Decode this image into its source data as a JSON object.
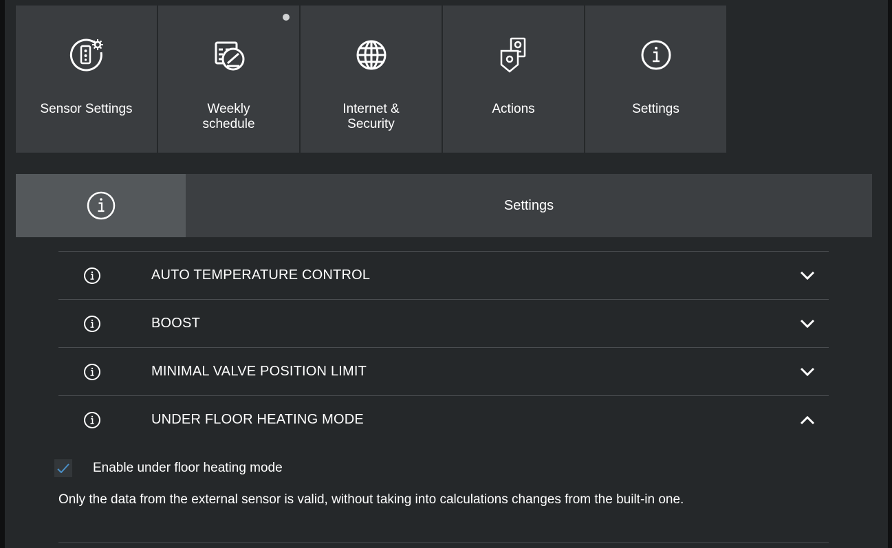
{
  "tiles": [
    {
      "label": "Sensor Settings",
      "icon": "sensor-settings-icon"
    },
    {
      "label": "Weekly\nschedule",
      "icon": "weekly-schedule-icon",
      "badge": true
    },
    {
      "label": "Internet &\nSecurity",
      "icon": "globe-icon"
    },
    {
      "label": "Actions",
      "icon": "actions-icon"
    },
    {
      "label": "Settings",
      "icon": "info-icon"
    }
  ],
  "section": {
    "title": "Settings",
    "icon": "info-icon"
  },
  "accordion": [
    {
      "label": "AUTO TEMPERATURE CONTROL",
      "expanded": false
    },
    {
      "label": "BOOST",
      "expanded": false
    },
    {
      "label": "MINIMAL VALVE POSITION LIMIT",
      "expanded": false
    },
    {
      "label": "UNDER FLOOR HEATING MODE",
      "expanded": true
    }
  ],
  "under_floor": {
    "checkbox_label": "Enable under floor heating mode",
    "checked": true,
    "description": "Only the data from the external sensor is valid, without taking into calculations changes from the built-in one."
  },
  "colors": {
    "background": "#25282a",
    "tile": "#3a3d40",
    "header": "#3c3f42",
    "header_icon_bg": "#54585b",
    "check_accent": "#4a90c8"
  }
}
